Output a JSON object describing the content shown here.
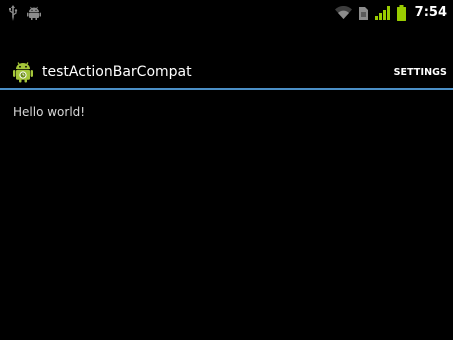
{
  "status_bar": {
    "time": "7:54",
    "left_icons": [
      "usb-icon",
      "android-debug-icon"
    ],
    "right_icons": [
      "wifi-icon",
      "sim-card-icon",
      "signal-icon",
      "battery-icon"
    ],
    "icon_color": "#8c8c8c",
    "accent_color": "#99cc00"
  },
  "action_bar": {
    "title": "testActionBarCompat",
    "app_icon": "android-app-icon",
    "action_settings_label": "SETTINGS",
    "divider_color": "#4b8fc6"
  },
  "content": {
    "text": "Hello world!"
  }
}
